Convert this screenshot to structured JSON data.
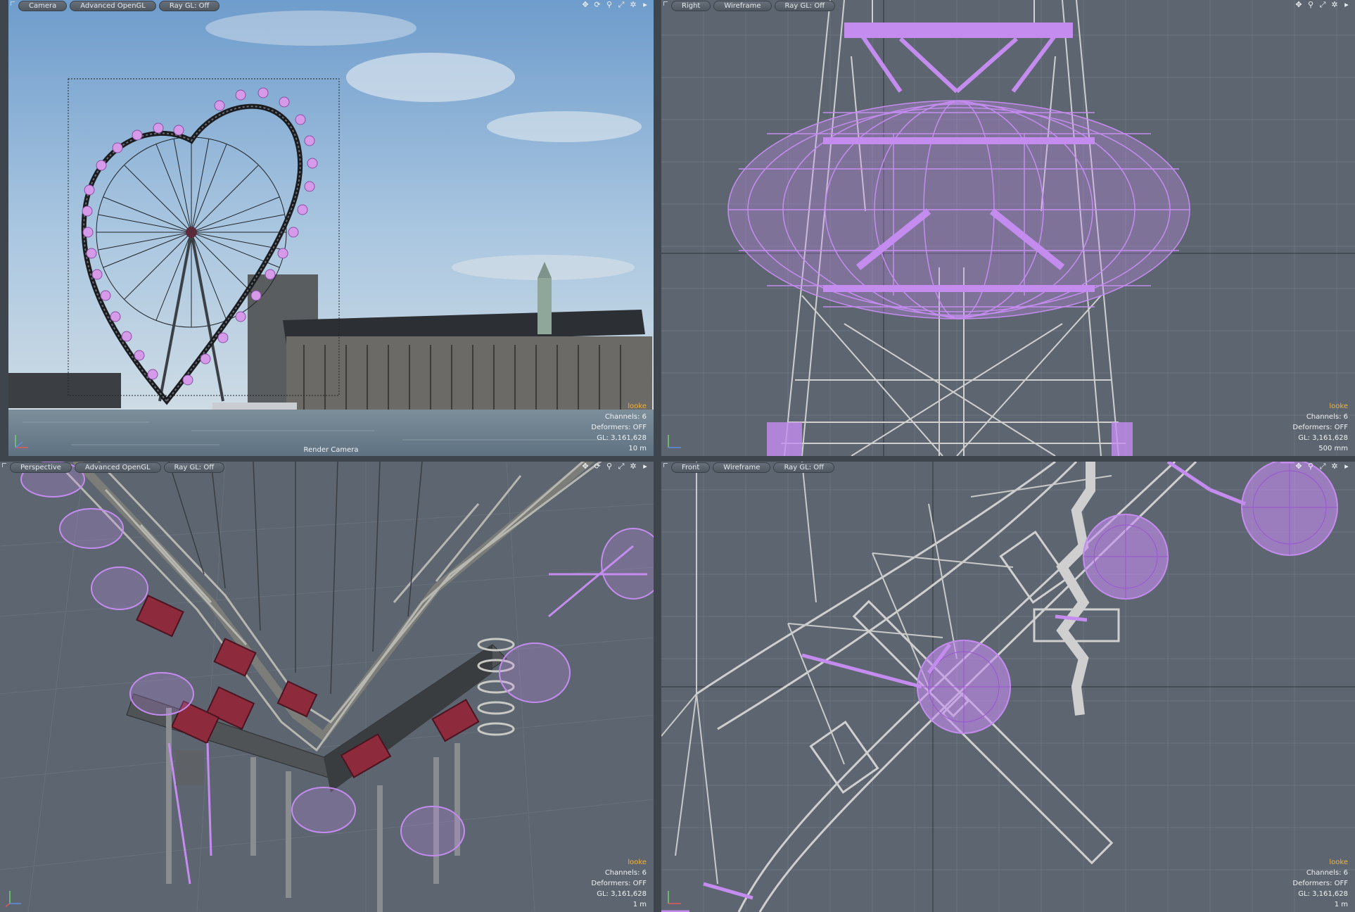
{
  "viewports": {
    "camera": {
      "tabs": [
        "Camera",
        "Advanced OpenGL",
        "Ray GL: Off"
      ],
      "footer": "Render Camera",
      "info": {
        "user": "looke",
        "channels": "Channels: 6",
        "deformers": "Deformers: OFF",
        "gl": "GL: 3,161,628",
        "scale": "10 m"
      }
    },
    "right": {
      "tabs": [
        "Right",
        "Wireframe",
        "Ray GL: Off"
      ],
      "info": {
        "user": "looke",
        "channels": "Channels: 6",
        "deformers": "Deformers: OFF",
        "gl": "GL: 3,161,628",
        "scale": "500 mm"
      }
    },
    "perspective": {
      "tabs": [
        "Perspective",
        "Advanced OpenGL",
        "Ray GL: Off"
      ],
      "info": {
        "user": "looke",
        "channels": "Channels: 6",
        "deformers": "Deformers: OFF",
        "gl": "GL: 3,161,628",
        "scale": "1 m"
      }
    },
    "front": {
      "tabs": [
        "Front",
        "Wireframe",
        "Ray GL: Off"
      ],
      "info": {
        "user": "looke",
        "channels": "Channels: 6",
        "deformers": "Deformers: OFF",
        "gl": "GL: 3,161,628",
        "scale": "1 m"
      }
    }
  },
  "toolbar_icons": [
    "move-icon",
    "rotate-icon",
    "zoom-icon",
    "maximize-icon",
    "settings-icon",
    "menu-arrow-icon"
  ],
  "colors": {
    "selection": "#c58cf0",
    "wire": "#c9c9c9",
    "info_user": "#f2b33d",
    "viewport_bg": "#5d6670"
  }
}
